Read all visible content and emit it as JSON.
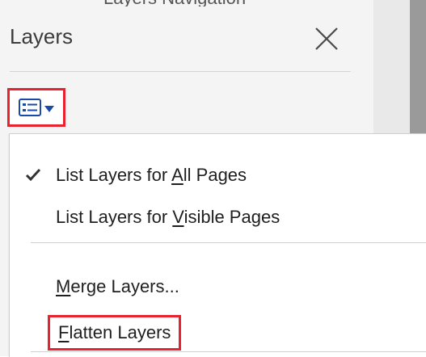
{
  "window": {
    "top_crop_text": "Layers Navigation"
  },
  "layers_panel": {
    "title": "Layers",
    "close_icon": "close-icon",
    "options_icon": "list-options-icon",
    "dropdown_icon": "chevron-down-icon"
  },
  "menu": {
    "items": [
      {
        "pre": "List Layers for ",
        "mnemonic": "A",
        "post": "ll Pages",
        "checked": true
      },
      {
        "pre": "List Layers for ",
        "mnemonic": "V",
        "post": "isible Pages",
        "checked": false
      },
      {
        "pre": "",
        "mnemonic": "M",
        "post": "erge Layers...",
        "checked": false
      },
      {
        "pre": "",
        "mnemonic": "F",
        "post": "latten Layers",
        "checked": false,
        "highlighted": true
      }
    ]
  },
  "colors": {
    "highlight_border": "#e6232f",
    "icon_blue": "#1a4aa8",
    "panel_bg": "#f4f4f4",
    "menu_bg": "#ffffff"
  }
}
